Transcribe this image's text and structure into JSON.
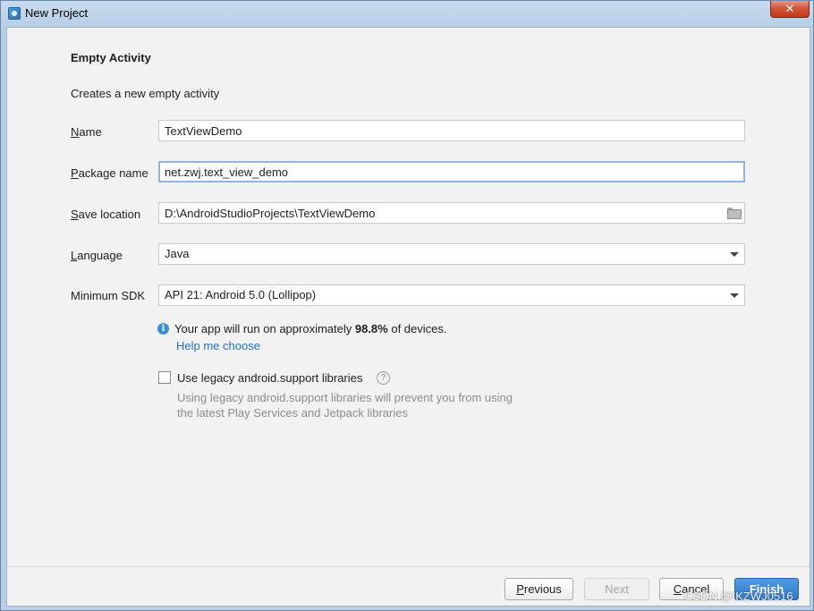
{
  "window": {
    "title": "New Project",
    "close_label": "✕"
  },
  "page": {
    "heading": "Empty Activity",
    "subtitle": "Creates a new empty activity"
  },
  "form": {
    "name": {
      "label_ul": "N",
      "label_rest": "ame",
      "value": "TextViewDemo"
    },
    "package": {
      "label_ul": "P",
      "label_rest": "ackage name",
      "value": "net.zwj.text_view_demo"
    },
    "save_location": {
      "label_ul": "S",
      "label_rest": "ave location",
      "value": "D:\\AndroidStudioProjects\\TextViewDemo"
    },
    "language": {
      "label_ul": "L",
      "label_rest": "anguage",
      "value": "Java"
    },
    "min_sdk": {
      "label": "Minimum SDK",
      "value": "API 21: Android 5.0 (Lollipop)"
    }
  },
  "info": {
    "prefix": "Your app will run on approximately ",
    "percent": "98.8%",
    "suffix": " of devices.",
    "help_link": "Help me choose"
  },
  "legacy": {
    "checked": false,
    "label": "Use legacy android.support libraries",
    "help_line1": "Using legacy android.support libraries will prevent you from using",
    "help_line2": "the latest Play Services and Jetpack libraries"
  },
  "buttons": {
    "previous_ul": "P",
    "previous_rest": "revious",
    "next": "Next",
    "cancel_ul": "C",
    "cancel_rest": "ancel",
    "finish": "Finish"
  },
  "watermark": "CSDN @IKZWJ0516",
  "colors": {
    "accent": "#2f78c9",
    "link": "#2a6fb8",
    "info": "#3f8fd6"
  }
}
